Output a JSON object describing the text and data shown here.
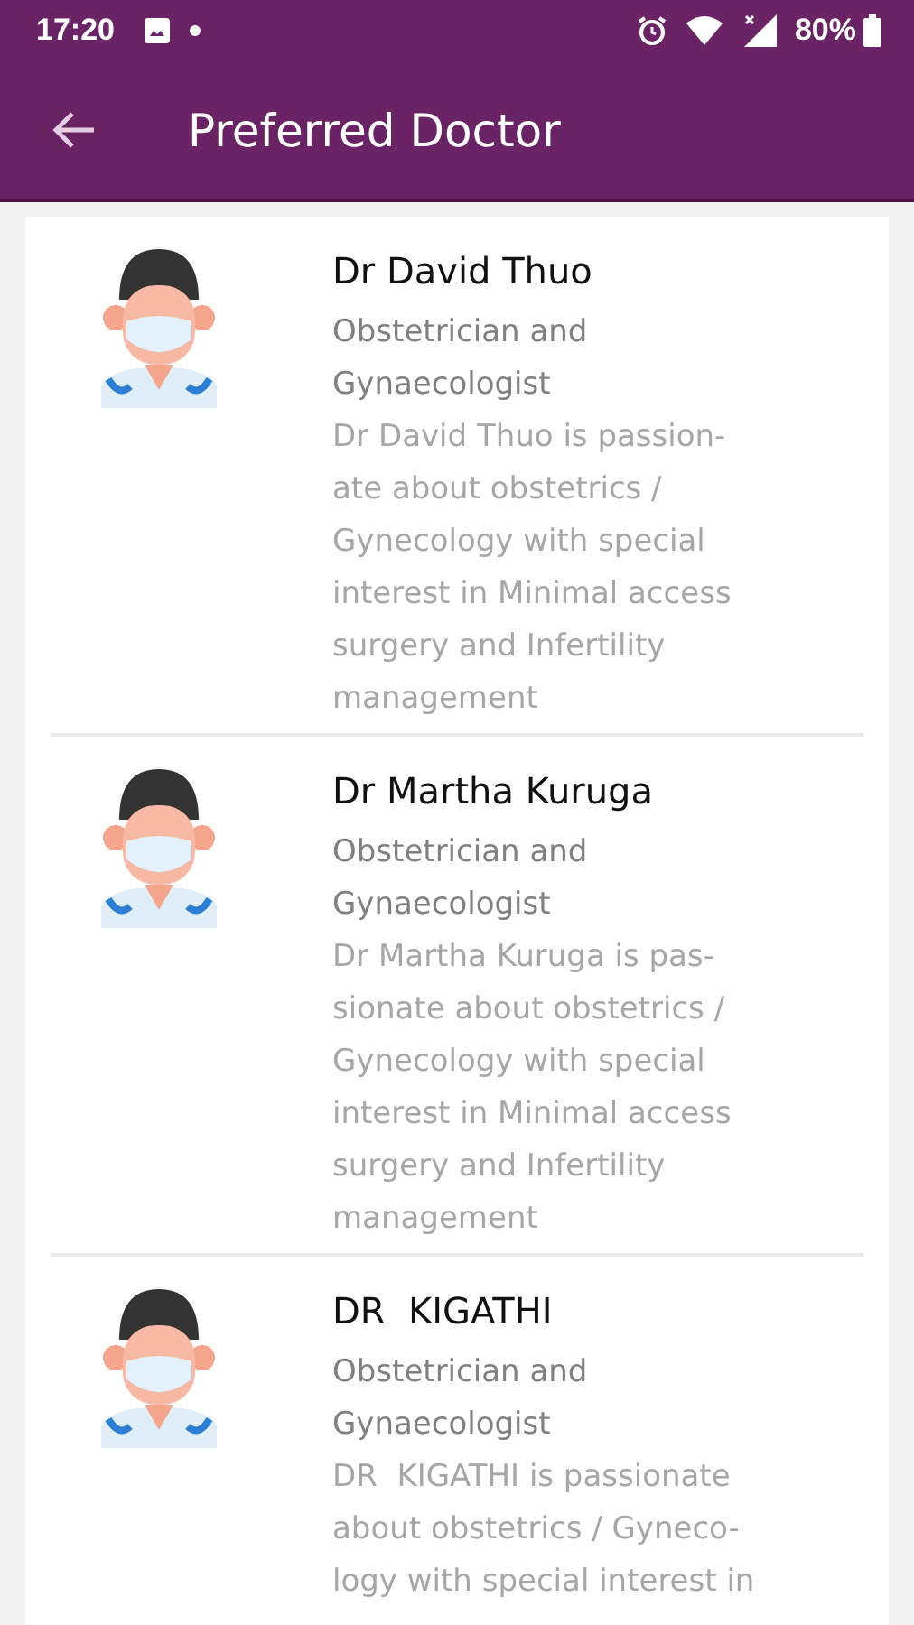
{
  "status_bar": {
    "time": "17:20",
    "battery": "80%"
  },
  "app_bar": {
    "title": "Preferred Doctor"
  },
  "doctors": [
    {
      "name": "Dr David Thuo",
      "specialty_lines": [
        "Obstetrician and",
        "Gynaecologist"
      ],
      "description_lines": [
        "Dr David Thuo is passion-",
        "ate about obstetrics /",
        "Gynecology with special",
        "interest in Minimal access",
        "surgery and Infertility",
        "management"
      ]
    },
    {
      "name": "Dr Martha Kuruga",
      "specialty_lines": [
        "Obstetrician and",
        "Gynaecologist"
      ],
      "description_lines": [
        "Dr Martha Kuruga is pas-",
        "sionate about obstetrics /",
        "Gynecology with special",
        "interest in Minimal access",
        "surgery and Infertility",
        "management"
      ]
    },
    {
      "name": "DR  KIGATHI",
      "specialty_lines": [
        "Obstetrician and",
        "Gynaecologist"
      ],
      "description_lines": [
        "DR  KIGATHI is passionate",
        "about obstetrics / Gyneco-",
        "logy with special interest in"
      ]
    }
  ]
}
